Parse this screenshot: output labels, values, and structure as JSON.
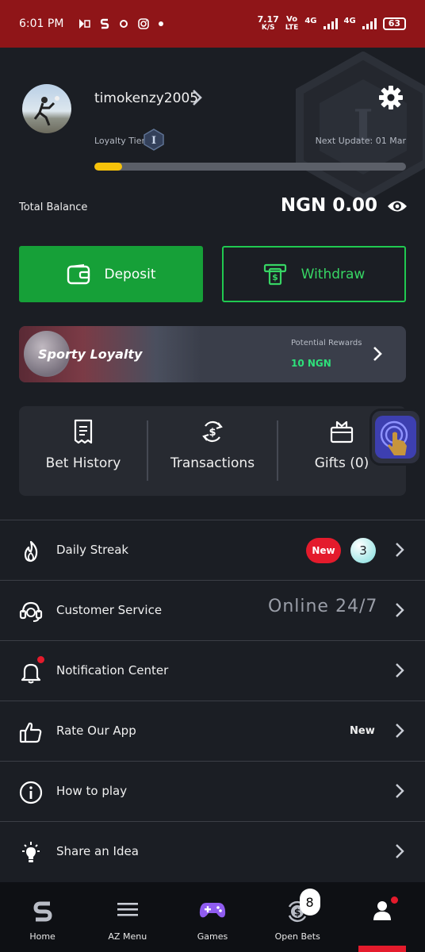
{
  "status_bar": {
    "time": "6:01 PM",
    "net_speed_value": "7.17",
    "net_speed_unit": "K/S",
    "carrier_top": "Vo",
    "carrier_bottom": "LTE",
    "network_1": "4G",
    "network_2": "4G",
    "battery": "63",
    "background_color": "#8f1518"
  },
  "profile": {
    "username": "timokenzy2005",
    "loyalty_tier_label": "Loyalty Tier:",
    "tier_badge": "I",
    "next_update": "Next Update: 01 Mar",
    "tier_progress_percent": 9
  },
  "balance": {
    "label": "Total Balance",
    "value": "NGN 0.00"
  },
  "actions": {
    "deposit_label": "Deposit",
    "withdraw_label": "Withdraw",
    "deposit_color": "#16a038",
    "withdraw_color": "#20c950"
  },
  "loyalty_banner": {
    "brand": "Sporty Loyalty",
    "rewards_label": "Potential Rewards",
    "rewards_value": "10 NGN"
  },
  "quick_actions": [
    {
      "label": "Bet History",
      "icon": "receipt-icon"
    },
    {
      "label": "Transactions",
      "icon": "money-transfer-icon"
    },
    {
      "label": "Gifts (0)",
      "icon": "gift-icon"
    }
  ],
  "menu": [
    {
      "label": "Daily Streak",
      "icon": "flame-icon",
      "badge": "New",
      "count": "3"
    },
    {
      "label": "Customer Service",
      "icon": "headset-icon",
      "status": "Online 24/7"
    },
    {
      "label": "Notification Center",
      "icon": "bell-icon"
    },
    {
      "label": "Rate Our App",
      "icon": "thumbs-up-icon",
      "tag": "New"
    },
    {
      "label": "How to play",
      "icon": "info-icon"
    },
    {
      "label": "Share an Idea",
      "icon": "lightbulb-icon"
    }
  ],
  "bottom_nav": [
    {
      "label": "Home",
      "icon": "sporty-logo-icon"
    },
    {
      "label": "AZ Menu",
      "icon": "hamburger-icon"
    },
    {
      "label": "Games",
      "icon": "gamepad-icon"
    },
    {
      "label": "Open Bets",
      "icon": "open-bets-icon",
      "count": "8"
    },
    {
      "label": "",
      "icon": "profile-icon",
      "active": true
    }
  ],
  "accent_color": "#e41b2c"
}
